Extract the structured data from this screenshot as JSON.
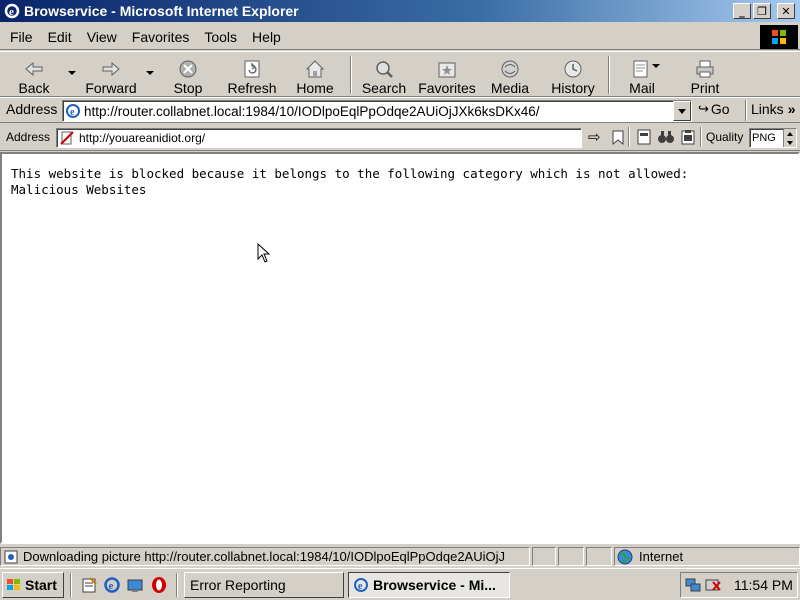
{
  "window": {
    "title": "Browservice - Microsoft Internet Explorer"
  },
  "menu": [
    "File",
    "Edit",
    "View",
    "Favorites",
    "Tools",
    "Help"
  ],
  "toolbar": {
    "back": "Back",
    "forward": "Forward",
    "stop": "Stop",
    "refresh": "Refresh",
    "home": "Home",
    "search": "Search",
    "favorites": "Favorites",
    "media": "Media",
    "history": "History",
    "mail": "Mail",
    "print": "Print"
  },
  "address": {
    "label": "Address",
    "url": "http://router.collabnet.local:1984/10/IODlpoEqlPpOdqe2AUiOjJXk6ksDKx46/",
    "go": "Go",
    "links": "Links"
  },
  "inner": {
    "label": "Address",
    "url": "http://youareanidiot.org/",
    "quality_label": "Quality",
    "quality_value": "PNG"
  },
  "page": {
    "line1": "This website is blocked because it belongs to the following category which is not allowed:",
    "line2": "Malicious Websites"
  },
  "status": {
    "text": "Downloading picture http://router.collabnet.local:1984/10/IODlpoEqlPpOdqe2AUiOjJ",
    "zone": "Internet"
  },
  "taskbar": {
    "start": "Start",
    "tasks": [
      "Error Reporting",
      "Browservice - Mi..."
    ],
    "clock": "11:54 PM"
  }
}
